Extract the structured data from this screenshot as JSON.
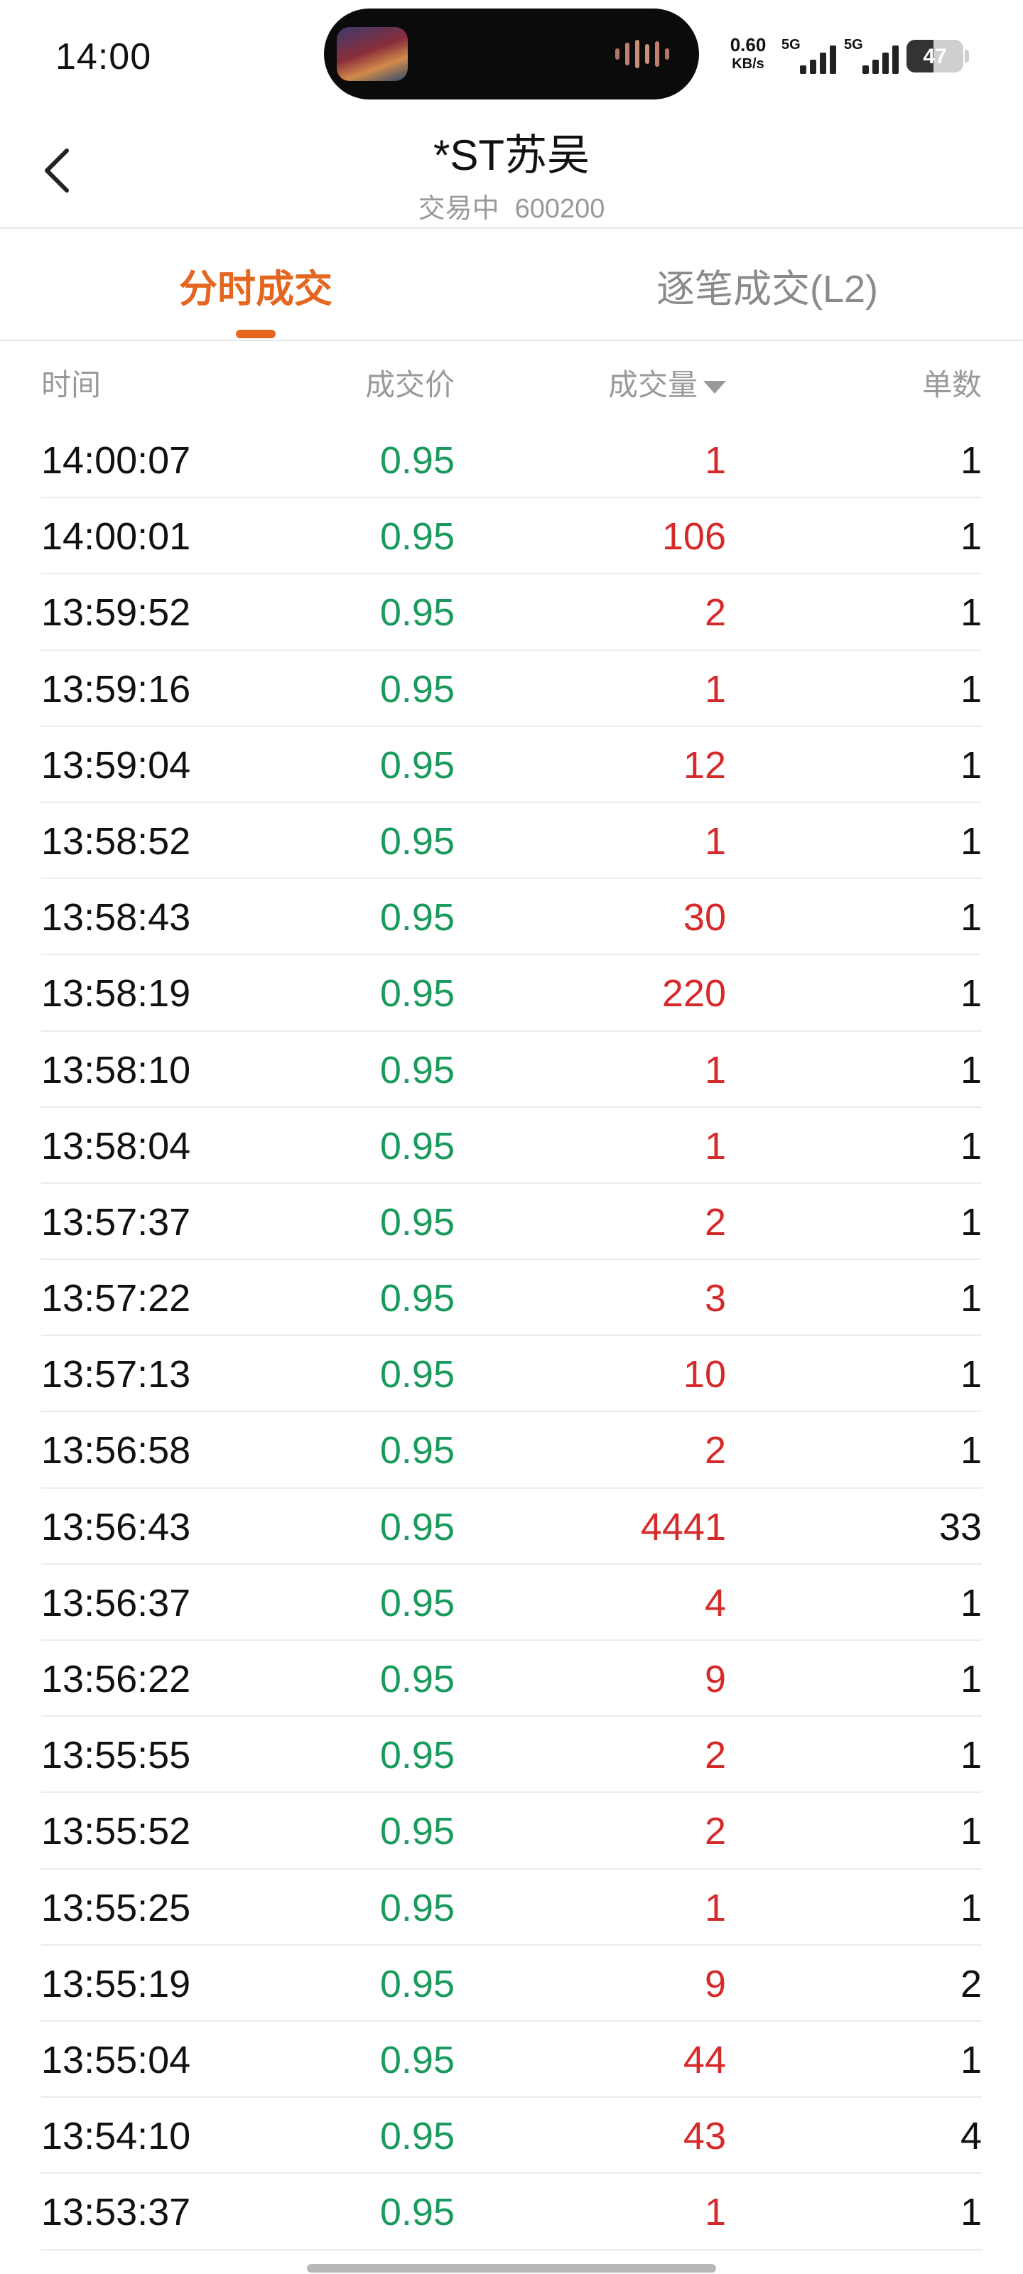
{
  "status_bar": {
    "time": "14:00",
    "net_speed_value": "0.60",
    "net_speed_unit": "KB/s",
    "sim1_label": "5G",
    "sim2_label": "5G",
    "battery_level": "47",
    "battery_fraction": 0.47
  },
  "header": {
    "title": "*ST苏吴",
    "status": "交易中",
    "code": "600200",
    "back_icon": "chevron-left-icon"
  },
  "tabs": [
    {
      "label": "分时成交",
      "active": true
    },
    {
      "label": "逐笔成交(L2)",
      "active": false
    }
  ],
  "columns": {
    "time": "时间",
    "price": "成交价",
    "volume": "成交量",
    "count": "单数",
    "sort_icon": "sort-desc-icon"
  },
  "colors": {
    "accent": "#e5661f",
    "price_down": "#1a9a5c",
    "volume": "#d62a2a",
    "muted": "#999999"
  },
  "trades": [
    {
      "time": "14:00:07",
      "price": "0.95",
      "volume": "1",
      "count": "1"
    },
    {
      "time": "14:00:01",
      "price": "0.95",
      "volume": "106",
      "count": "1"
    },
    {
      "time": "13:59:52",
      "price": "0.95",
      "volume": "2",
      "count": "1"
    },
    {
      "time": "13:59:16",
      "price": "0.95",
      "volume": "1",
      "count": "1"
    },
    {
      "time": "13:59:04",
      "price": "0.95",
      "volume": "12",
      "count": "1"
    },
    {
      "time": "13:58:52",
      "price": "0.95",
      "volume": "1",
      "count": "1"
    },
    {
      "time": "13:58:43",
      "price": "0.95",
      "volume": "30",
      "count": "1"
    },
    {
      "time": "13:58:19",
      "price": "0.95",
      "volume": "220",
      "count": "1"
    },
    {
      "time": "13:58:10",
      "price": "0.95",
      "volume": "1",
      "count": "1"
    },
    {
      "time": "13:58:04",
      "price": "0.95",
      "volume": "1",
      "count": "1"
    },
    {
      "time": "13:57:37",
      "price": "0.95",
      "volume": "2",
      "count": "1"
    },
    {
      "time": "13:57:22",
      "price": "0.95",
      "volume": "3",
      "count": "1"
    },
    {
      "time": "13:57:13",
      "price": "0.95",
      "volume": "10",
      "count": "1"
    },
    {
      "time": "13:56:58",
      "price": "0.95",
      "volume": "2",
      "count": "1"
    },
    {
      "time": "13:56:43",
      "price": "0.95",
      "volume": "4441",
      "count": "33"
    },
    {
      "time": "13:56:37",
      "price": "0.95",
      "volume": "4",
      "count": "1"
    },
    {
      "time": "13:56:22",
      "price": "0.95",
      "volume": "9",
      "count": "1"
    },
    {
      "time": "13:55:55",
      "price": "0.95",
      "volume": "2",
      "count": "1"
    },
    {
      "time": "13:55:52",
      "price": "0.95",
      "volume": "2",
      "count": "1"
    },
    {
      "time": "13:55:25",
      "price": "0.95",
      "volume": "1",
      "count": "1"
    },
    {
      "time": "13:55:19",
      "price": "0.95",
      "volume": "9",
      "count": "2"
    },
    {
      "time": "13:55:04",
      "price": "0.95",
      "volume": "44",
      "count": "1"
    },
    {
      "time": "13:54:10",
      "price": "0.95",
      "volume": "43",
      "count": "4"
    },
    {
      "time": "13:53:37",
      "price": "0.95",
      "volume": "1",
      "count": "1"
    }
  ]
}
